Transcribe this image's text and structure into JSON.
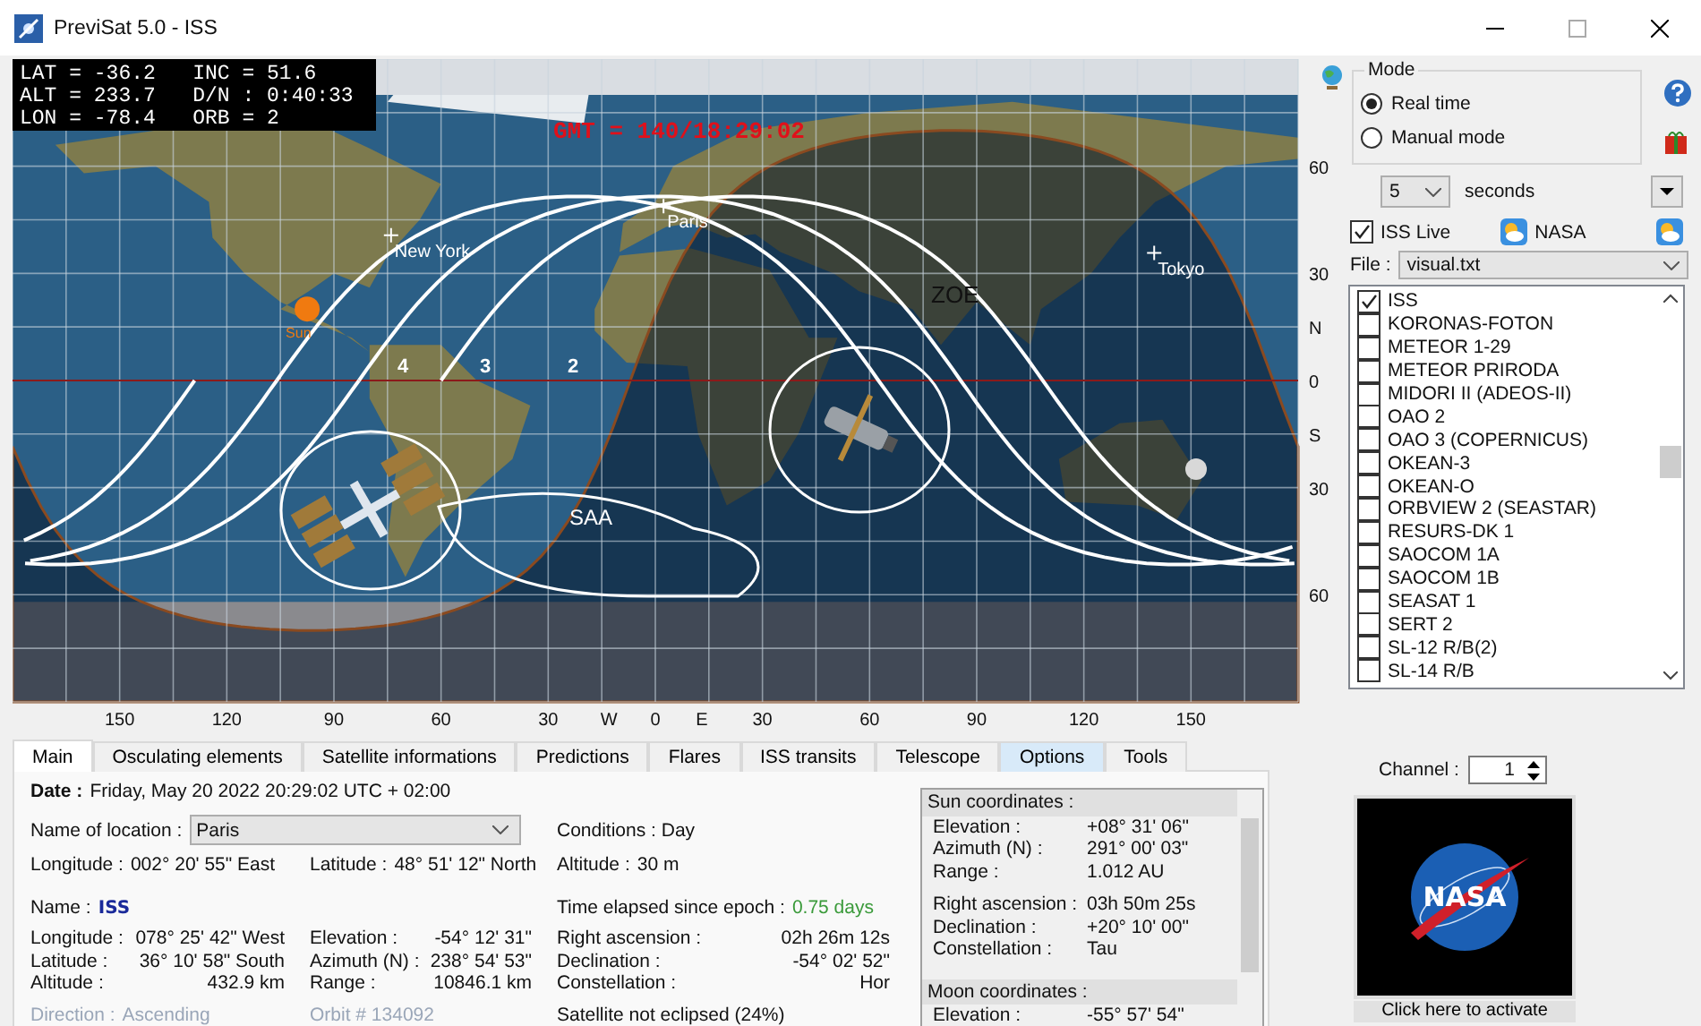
{
  "window": {
    "title": "PreviSat 5.0 - ISS"
  },
  "map": {
    "info": [
      "LAT = -36.2   INC = 51.6",
      "ALT = 233.7   D/N : 0:40:33",
      "LON = -78.4   ORB = 2"
    ],
    "gmt": "GMT = 140/18:29:02",
    "places": [
      {
        "name": "New York",
        "kind": "city"
      },
      {
        "name": "Paris",
        "kind": "city"
      },
      {
        "name": "Tokyo",
        "kind": "city"
      },
      {
        "name": "Sun",
        "kind": "sun"
      }
    ],
    "orbit_labels": [
      "4",
      "3",
      "2"
    ],
    "zones": [
      "ZOE",
      "SAA"
    ],
    "lat_labels": [
      "60",
      "30",
      "N",
      "0",
      "S",
      "30",
      "60"
    ],
    "lon_labels": [
      "150",
      "120",
      "90",
      "60",
      "30",
      "W",
      "0",
      "E",
      "30",
      "60",
      "90",
      "120",
      "150"
    ]
  },
  "mode": {
    "title": "Mode",
    "options": [
      {
        "label": "Real time",
        "selected": true
      },
      {
        "label": "Manual mode",
        "selected": false
      }
    ]
  },
  "interval": {
    "value": "5",
    "unit": "seconds"
  },
  "iss_live": {
    "label": "ISS Live",
    "checked": true
  },
  "nasa_label": "NASA",
  "file": {
    "label": "File :",
    "value": "visual.txt"
  },
  "satellites": [
    {
      "name": "ISS",
      "checked": true
    },
    {
      "name": "KORONAS-FOTON",
      "checked": false
    },
    {
      "name": "METEOR 1-29",
      "checked": false
    },
    {
      "name": "METEOR PRIRODA",
      "checked": false
    },
    {
      "name": "MIDORI II (ADEOS-II)",
      "checked": false
    },
    {
      "name": "OAO 2",
      "checked": false
    },
    {
      "name": "OAO 3 (COPERNICUS)",
      "checked": false
    },
    {
      "name": "OKEAN-3",
      "checked": false
    },
    {
      "name": "OKEAN-O",
      "checked": false
    },
    {
      "name": "ORBVIEW 2 (SEASTAR)",
      "checked": false
    },
    {
      "name": "RESURS-DK 1",
      "checked": false
    },
    {
      "name": "SAOCOM 1A",
      "checked": false
    },
    {
      "name": "SAOCOM 1B",
      "checked": false
    },
    {
      "name": "SEASAT 1",
      "checked": false
    },
    {
      "name": "SERT 2",
      "checked": false
    },
    {
      "name": "SL-12 R/B(2)",
      "checked": false
    },
    {
      "name": "SL-14 R/B",
      "checked": false
    }
  ],
  "tabs": [
    {
      "label": "Main",
      "selected": true,
      "hover": false
    },
    {
      "label": "Osculating elements",
      "selected": false,
      "hover": false
    },
    {
      "label": "Satellite informations",
      "selected": false,
      "hover": false
    },
    {
      "label": "Predictions",
      "selected": false,
      "hover": false
    },
    {
      "label": "Flares",
      "selected": false,
      "hover": false
    },
    {
      "label": "ISS transits",
      "selected": false,
      "hover": false
    },
    {
      "label": "Telescope",
      "selected": false,
      "hover": false
    },
    {
      "label": "Options",
      "selected": false,
      "hover": true
    },
    {
      "label": "Tools",
      "selected": false,
      "hover": false
    }
  ],
  "main": {
    "date": {
      "label": "Date :",
      "value": "Friday, May 20 2022  20:29:02  UTC + 02:00"
    },
    "location": {
      "label": "Name of location :",
      "value": "Paris"
    },
    "conditions": "Conditions : Day",
    "observer": [
      {
        "label": "Longitude :",
        "value": "002° 20' 55\" East"
      },
      {
        "label": "Latitude :",
        "value": "48° 51' 12\" North"
      },
      {
        "label": "Altitude :",
        "value": "30 m"
      }
    ],
    "name": {
      "label": "Name :",
      "value": "ISS"
    },
    "epoch": {
      "label": "Time elapsed since epoch :",
      "value": "0.75 days"
    },
    "sat_columns": [
      [
        {
          "label": "Longitude :",
          "value": "078° 25' 42\" West"
        },
        {
          "label": "Latitude :",
          "value": "36° 10' 58\" South"
        },
        {
          "label": "Altitude :",
          "value": "432.9 km"
        }
      ],
      [
        {
          "label": "Elevation :",
          "value": "-54° 12' 31\""
        },
        {
          "label": "Azimuth (N) :",
          "value": "238° 54' 53\""
        },
        {
          "label": "Range :",
          "value": "10846.1 km"
        }
      ],
      [
        {
          "label": "Right ascension :",
          "value": "02h 26m 12s"
        },
        {
          "label": "Declination :",
          "value": "-54° 02' 52\""
        },
        {
          "label": "Constellation :",
          "value": "Hor"
        }
      ]
    ],
    "direction": {
      "label": "Direction :",
      "value": "Ascending"
    },
    "orbit": "Orbit # 134092",
    "eclipse": "Satellite not eclipsed (24%)"
  },
  "sun": {
    "title": "Sun coordinates :",
    "rows": [
      {
        "label": "Elevation :",
        "value": "+08° 31' 06\""
      },
      {
        "label": "Azimuth (N) :",
        "value": "291° 00' 03\""
      },
      {
        "label": "Range :",
        "value": "1.012 AU"
      }
    ],
    "rows2": [
      {
        "label": "Right ascension :",
        "value": "03h 50m 25s"
      },
      {
        "label": "Declination :",
        "value": "+20° 10' 00\""
      },
      {
        "label": "Constellation :",
        "value": "Tau"
      }
    ]
  },
  "moon": {
    "title": "Moon coordinates :",
    "rows": [
      {
        "label": "Elevation :",
        "value": "-55° 57' 54\""
      }
    ]
  },
  "channel": {
    "label": "Channel :",
    "value": "1"
  },
  "video": {
    "logo": "NASA",
    "button": "Click here to activate"
  }
}
